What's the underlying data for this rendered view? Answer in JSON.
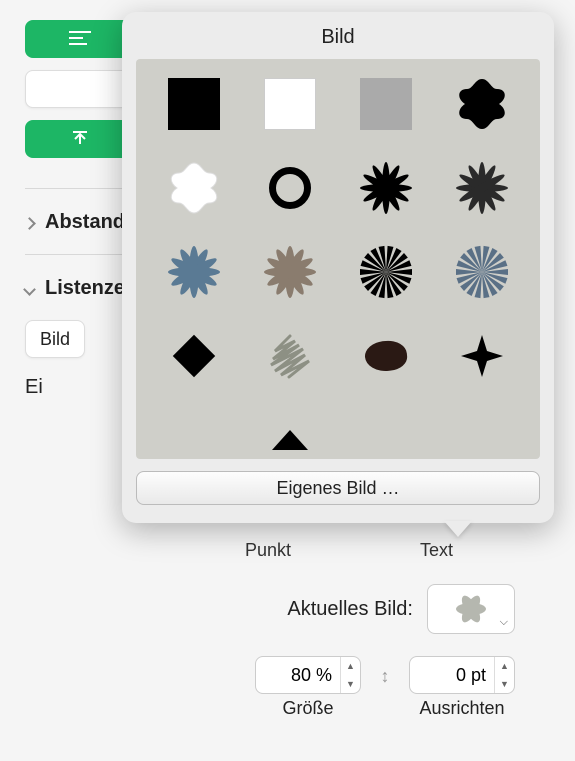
{
  "buttons": {
    "green1_icon": "align-left",
    "green2_icon": "arrow-up"
  },
  "section_spacing_label": "Abstand",
  "section_list_label": "Listenzeichen & Listen",
  "list_type_select": "Bild",
  "indent_label_truncated": "Ei",
  "popover": {
    "title": "Bild",
    "custom_button": "Eigenes Bild …",
    "bullets": [
      "square-black",
      "square-white",
      "square-gray",
      "quatrefoil-black",
      "quatrefoil-white",
      "ring-black",
      "starburst-black",
      "starburst-dark",
      "starburst-steel",
      "starburst-warm",
      "sunburst-bw",
      "sunburst-steel",
      "diamond-black",
      "scribble-gray",
      "blob-brown",
      "sparkle-black",
      "triangle-black-partial"
    ]
  },
  "column_labels": {
    "punkt": "Punkt",
    "text": "Text"
  },
  "current_image": {
    "label": "Aktuelles Bild:"
  },
  "steppers": {
    "size": {
      "value": "80 %",
      "label": "Größe"
    },
    "align": {
      "value": "0 pt",
      "label": "Ausrichten"
    }
  }
}
